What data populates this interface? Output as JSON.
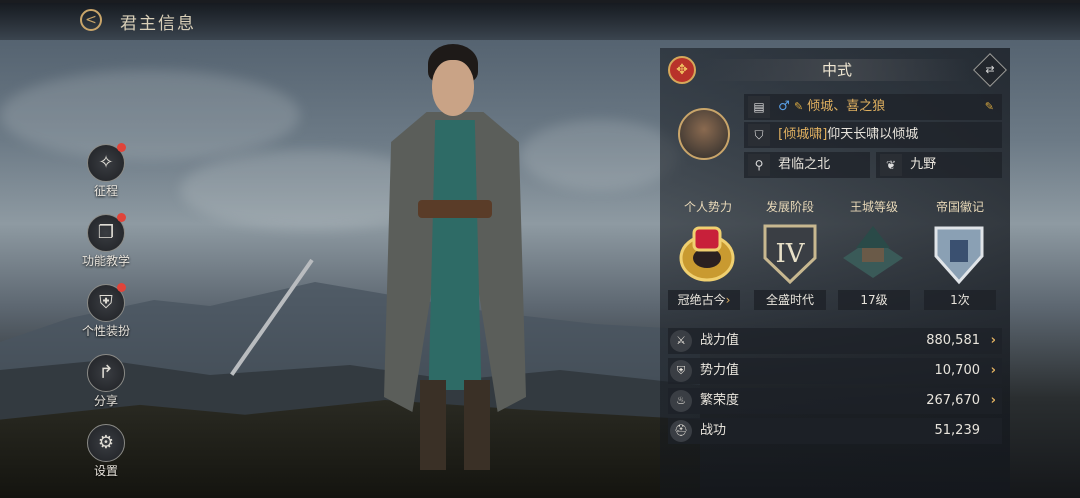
{
  "header": {
    "title": "君主信息",
    "back_icon": "back-arrow-icon"
  },
  "side_menu": [
    {
      "label": "征程",
      "icon": "compass-icon",
      "has_dot": true
    },
    {
      "label": "功能教学",
      "icon": "book-icon",
      "has_dot": true
    },
    {
      "label": "个性装扮",
      "icon": "armor-icon",
      "has_dot": true
    },
    {
      "label": "分享",
      "icon": "share-arrow-icon",
      "has_dot": false
    },
    {
      "label": "设置",
      "icon": "gear-icon",
      "has_dot": false
    }
  ],
  "style_bar": {
    "name": "中式",
    "emblem_icon": "knot-emblem-icon",
    "swap_icon": "swap-icon"
  },
  "profile": {
    "name": "倾城、喜之狼",
    "gender_symbol": "♂",
    "signature_prefix": "[倾城啸]",
    "signature_text": "仰天长啸以倾城",
    "location": "君临之北",
    "alliance": "九野"
  },
  "stat_headers": [
    "个人势力",
    "发展阶段",
    "王城等级",
    "帝国徽记"
  ],
  "badges": [
    {
      "label": "冠绝古今",
      "icon": "ruby-ring-icon",
      "has_chevron": true
    },
    {
      "label": "全盛时代",
      "icon": "roman-four-shield-icon",
      "numeral": "IV",
      "has_chevron": false
    },
    {
      "label": "17级",
      "icon": "palace-icon",
      "has_chevron": false
    },
    {
      "label": "1次",
      "icon": "crest-icon",
      "has_chevron": false
    }
  ],
  "stats": [
    {
      "name": "战力值",
      "value": "880,581",
      "icon": "power-icon",
      "has_chevron": true
    },
    {
      "name": "势力值",
      "value": "10,700",
      "icon": "shield-icon",
      "has_chevron": true
    },
    {
      "name": "繁荣度",
      "value": "267,670",
      "icon": "flame-icon",
      "has_chevron": true
    },
    {
      "name": "战功",
      "value": "51,239",
      "icon": "helmet-icon",
      "has_chevron": false
    }
  ],
  "colors": {
    "accent_gold": "#c9a56a",
    "notify_red": "#e0443a",
    "male_blue": "#5aa0e8"
  }
}
